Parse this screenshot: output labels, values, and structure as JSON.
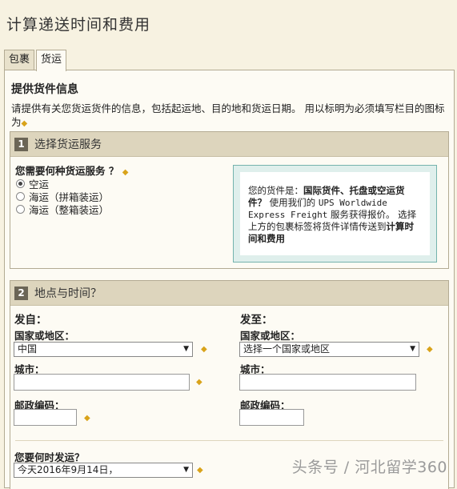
{
  "page": {
    "title": "计算递送时间和费用"
  },
  "tabs": [
    {
      "label": "包裹",
      "active": false
    },
    {
      "label": "货运",
      "active": true
    }
  ],
  "section": {
    "heading": "提供货件信息",
    "intro": "请提供有关您货运货件的信息，包括起运地、目的地和货运日期。 用以标明为必须填写栏目的图标为"
  },
  "service": {
    "number": "1",
    "title": "选择货运服务",
    "question": "您需要何种货运服务 ？",
    "options": [
      {
        "label": "空运",
        "checked": true
      },
      {
        "label": "海运（拼箱装运）",
        "checked": false
      },
      {
        "label": "海运（整箱装运）",
        "checked": false
      }
    ],
    "info": {
      "prefix": "您的货件是：",
      "bold1": "国际货件、托盘或空运货件？",
      "mid1": " 使用我们的 ",
      "mono": "UPS Worldwide Express Freight",
      "mid2": " 服务获得报价。 选择上方的包裹标签将货件详情传送到",
      "bold2": "计算时间和费用"
    }
  },
  "location": {
    "number": "2",
    "title": "地点与时间？",
    "from": {
      "heading": "发自：",
      "country_label": "国家或地区：",
      "country_value": "中国",
      "city_label": "城市：",
      "postal_label": "邮政编码："
    },
    "to": {
      "heading": "发至：",
      "country_label": "国家或地区：",
      "country_value": "选择一个国家或地区",
      "city_label": "城市：",
      "postal_label": "邮政编码："
    },
    "when_label": "您要何时发运？",
    "date_value": "今天2016年9月14日，"
  },
  "icons": {
    "required": "required-diamond-icon",
    "dropdown": "chevron-down-icon"
  },
  "colors": {
    "page_bg": "#f7f2e1",
    "panel_header": "#ddd5bd",
    "required": "#d9a31a",
    "info_border": "#74b3ad"
  },
  "watermark": "头条号 / 河北留学360"
}
